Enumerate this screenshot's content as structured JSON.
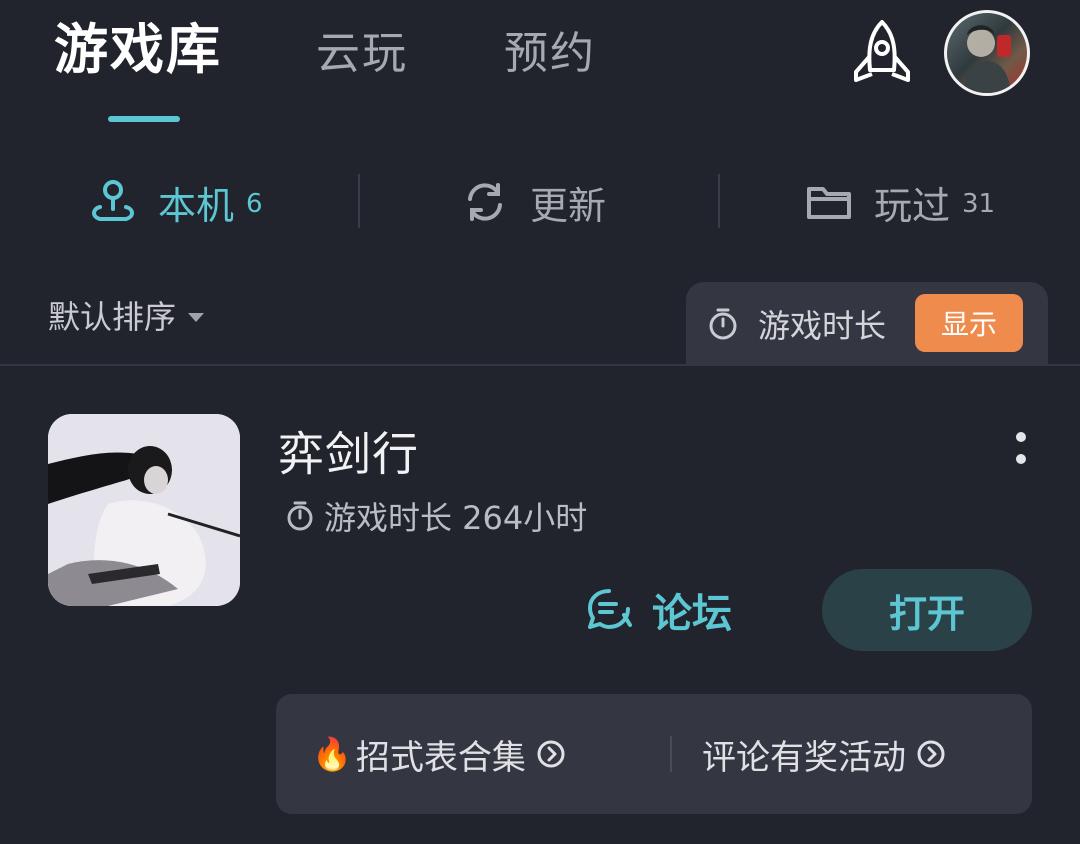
{
  "top_tabs": {
    "library": "游戏库",
    "cloud": "云玩",
    "reserve": "预约"
  },
  "header_icons": {
    "rocket": "rocket-icon",
    "avatar": "user-avatar"
  },
  "sub_tabs": {
    "local": {
      "label": "本机",
      "count": "6",
      "icon": "joystick-location-icon"
    },
    "update": {
      "label": "更新",
      "icon": "refresh-icon"
    },
    "played": {
      "label": "玩过",
      "count": "31",
      "icon": "folder-icon"
    }
  },
  "sort": {
    "label": "默认排序"
  },
  "playtime_toggle": {
    "label": "游戏时长",
    "button": "显示"
  },
  "game": {
    "title": "弈剑行",
    "playtime": "游戏时长 264小时",
    "forum_label": "论坛",
    "open_label": "打开",
    "links": [
      {
        "prefix_icon": "fire-icon",
        "label": "招式表合集"
      },
      {
        "label": "评论有奖活动"
      }
    ]
  },
  "colors": {
    "background": "#22242d",
    "accent": "#5cc6d3",
    "show_button": "#f08b4e",
    "panel": "#343741"
  }
}
